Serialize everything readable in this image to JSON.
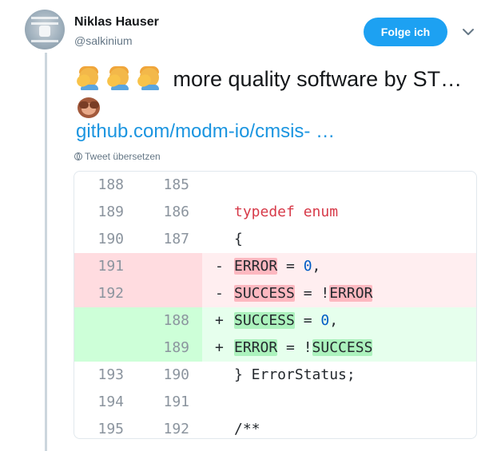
{
  "author": {
    "name": "Niklas Hauser",
    "handle": "@salkinium"
  },
  "follow_label": "Folge ich",
  "tweet": {
    "text": "more quality software by ST…",
    "link": "github.com/modm-io/cmsis-",
    "link_ellipsis": " …",
    "translate_label": "Tweet übersetzen"
  },
  "icons": [
    "avatar",
    "chevron-down-icon",
    "facepalm-emoji",
    "see-no-evil-monkey-emoji",
    "globe-icon"
  ],
  "colors": {
    "accent": "#1da1f2",
    "link": "#1b95e0",
    "deleted": "#ffeef0",
    "added": "#e6ffed"
  },
  "diff": {
    "rows": [
      {
        "type": "context",
        "old": "188",
        "new": "185",
        "sign": "",
        "code": ""
      },
      {
        "type": "context",
        "old": "189",
        "new": "186",
        "sign": "",
        "code": "typedef enum"
      },
      {
        "type": "context",
        "old": "190",
        "new": "187",
        "sign": "",
        "code": "{"
      },
      {
        "type": "del",
        "old": "191",
        "new": "",
        "sign": "-",
        "code": "ERROR = 0,"
      },
      {
        "type": "del",
        "old": "192",
        "new": "",
        "sign": "-",
        "code": "SUCCESS = !ERROR"
      },
      {
        "type": "add",
        "old": "",
        "new": "188",
        "sign": "+",
        "code": "SUCCESS = 0,"
      },
      {
        "type": "add",
        "old": "",
        "new": "189",
        "sign": "+",
        "code": "ERROR = !SUCCESS"
      },
      {
        "type": "context",
        "old": "193",
        "new": "190",
        "sign": "",
        "code": "} ErrorStatus;"
      },
      {
        "type": "context",
        "old": "194",
        "new": "191",
        "sign": "",
        "code": ""
      },
      {
        "type": "context",
        "old": "195",
        "new": "192",
        "sign": "",
        "code": "/**"
      }
    ]
  }
}
